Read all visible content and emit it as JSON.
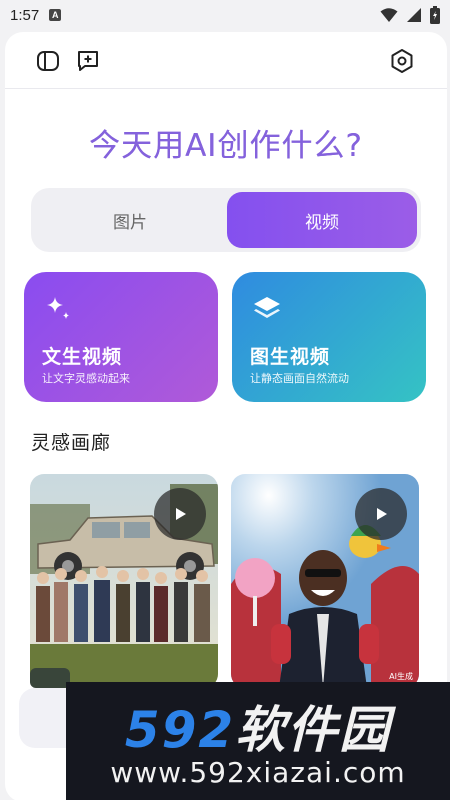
{
  "status_bar": {
    "time": "1:57",
    "badge": "A"
  },
  "toolbar": {
    "sidebar_icon": "sidebar-toggle-icon",
    "new_chat_icon": "new-chat-icon",
    "settings_icon": "settings-hexagon-icon"
  },
  "headline": "今天用AI创作什么?",
  "segment": {
    "tabs": [
      {
        "label": "图片",
        "selected": false
      },
      {
        "label": "视频",
        "selected": true
      }
    ]
  },
  "features": [
    {
      "title": "文生视频",
      "subtitle": "让文字灵感动起来",
      "icon": "sparkle-icon"
    },
    {
      "title": "图生视频",
      "subtitle": "让静态画面自然流动",
      "icon": "layers-icon"
    }
  ],
  "gallery": {
    "title": "灵感画廊",
    "items": [
      {
        "description": "people-lifting-car",
        "play_icon": "play-icon"
      },
      {
        "description": "man-on-rollercoaster",
        "play_icon": "play-icon",
        "tag": "AI生成"
      }
    ]
  },
  "watermark": {
    "logo_number": "592",
    "logo_text": "软件园",
    "url": "www.592xiazai.com"
  },
  "colors": {
    "accent_purple": "#8450ef",
    "feature_blue": "#2f8be0",
    "watermark_blue": "#2c82e8"
  }
}
